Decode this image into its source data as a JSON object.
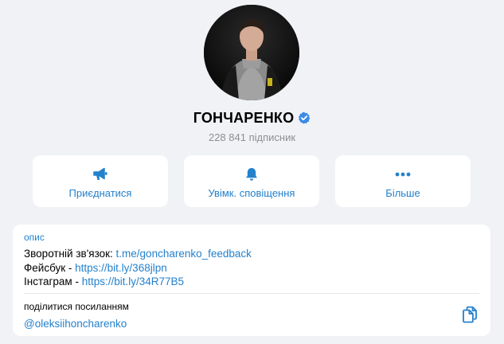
{
  "channel": {
    "name": "ГОНЧАРЕНКО",
    "subscribers": "228 841 підписник",
    "verified": true
  },
  "actions": [
    {
      "label": "Приєднатися",
      "icon": "megaphone-icon"
    },
    {
      "label": "Увімк. сповіщення",
      "icon": "bell-icon"
    },
    {
      "label": "Більше",
      "icon": "more-dots-icon"
    }
  ],
  "about": {
    "section_label": "опис",
    "lines": [
      {
        "prefix": "Зворотній зв'язок: ",
        "link": "t.me/goncharenko_feedback"
      },
      {
        "prefix": "Фейсбук - ",
        "link": "https://bit.ly/368jlpn"
      },
      {
        "prefix": "Інстаграм - ",
        "link": "https://bit.ly/34R77B5"
      }
    ]
  },
  "share": {
    "label": "поділитися посиланням",
    "link": "@oleksiihoncharenko",
    "icon": "copy-icon"
  },
  "colors": {
    "background": "#f1f2f6",
    "card": "#ffffff",
    "accent": "#2481cc",
    "muted": "#8e8e93",
    "verified": "#3b8ae6"
  }
}
